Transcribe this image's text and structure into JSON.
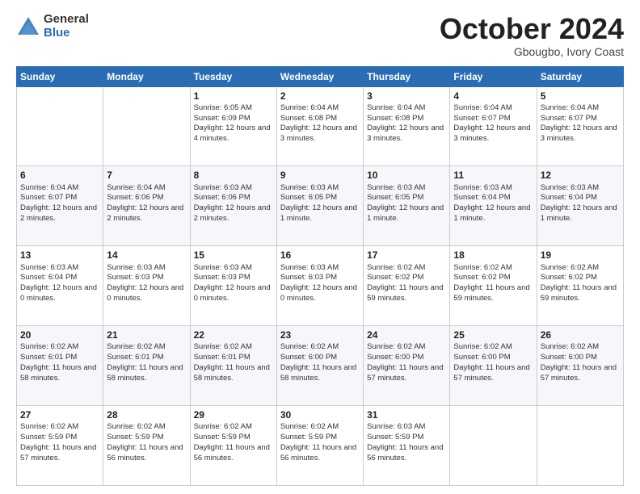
{
  "logo": {
    "general": "General",
    "blue": "Blue"
  },
  "header": {
    "month": "October 2024",
    "location": "Gbougbo, Ivory Coast"
  },
  "weekdays": [
    "Sunday",
    "Monday",
    "Tuesday",
    "Wednesday",
    "Thursday",
    "Friday",
    "Saturday"
  ],
  "weeks": [
    [
      {
        "day": "",
        "detail": ""
      },
      {
        "day": "",
        "detail": ""
      },
      {
        "day": "1",
        "detail": "Sunrise: 6:05 AM\nSunset: 6:09 PM\nDaylight: 12 hours\nand 4 minutes."
      },
      {
        "day": "2",
        "detail": "Sunrise: 6:04 AM\nSunset: 6:08 PM\nDaylight: 12 hours\nand 3 minutes."
      },
      {
        "day": "3",
        "detail": "Sunrise: 6:04 AM\nSunset: 6:08 PM\nDaylight: 12 hours\nand 3 minutes."
      },
      {
        "day": "4",
        "detail": "Sunrise: 6:04 AM\nSunset: 6:07 PM\nDaylight: 12 hours\nand 3 minutes."
      },
      {
        "day": "5",
        "detail": "Sunrise: 6:04 AM\nSunset: 6:07 PM\nDaylight: 12 hours\nand 3 minutes."
      }
    ],
    [
      {
        "day": "6",
        "detail": "Sunrise: 6:04 AM\nSunset: 6:07 PM\nDaylight: 12 hours\nand 2 minutes."
      },
      {
        "day": "7",
        "detail": "Sunrise: 6:04 AM\nSunset: 6:06 PM\nDaylight: 12 hours\nand 2 minutes."
      },
      {
        "day": "8",
        "detail": "Sunrise: 6:03 AM\nSunset: 6:06 PM\nDaylight: 12 hours\nand 2 minutes."
      },
      {
        "day": "9",
        "detail": "Sunrise: 6:03 AM\nSunset: 6:05 PM\nDaylight: 12 hours\nand 1 minute."
      },
      {
        "day": "10",
        "detail": "Sunrise: 6:03 AM\nSunset: 6:05 PM\nDaylight: 12 hours\nand 1 minute."
      },
      {
        "day": "11",
        "detail": "Sunrise: 6:03 AM\nSunset: 6:04 PM\nDaylight: 12 hours\nand 1 minute."
      },
      {
        "day": "12",
        "detail": "Sunrise: 6:03 AM\nSunset: 6:04 PM\nDaylight: 12 hours\nand 1 minute."
      }
    ],
    [
      {
        "day": "13",
        "detail": "Sunrise: 6:03 AM\nSunset: 6:04 PM\nDaylight: 12 hours\nand 0 minutes."
      },
      {
        "day": "14",
        "detail": "Sunrise: 6:03 AM\nSunset: 6:03 PM\nDaylight: 12 hours\nand 0 minutes."
      },
      {
        "day": "15",
        "detail": "Sunrise: 6:03 AM\nSunset: 6:03 PM\nDaylight: 12 hours\nand 0 minutes."
      },
      {
        "day": "16",
        "detail": "Sunrise: 6:03 AM\nSunset: 6:03 PM\nDaylight: 12 hours\nand 0 minutes."
      },
      {
        "day": "17",
        "detail": "Sunrise: 6:02 AM\nSunset: 6:02 PM\nDaylight: 11 hours\nand 59 minutes."
      },
      {
        "day": "18",
        "detail": "Sunrise: 6:02 AM\nSunset: 6:02 PM\nDaylight: 11 hours\nand 59 minutes."
      },
      {
        "day": "19",
        "detail": "Sunrise: 6:02 AM\nSunset: 6:02 PM\nDaylight: 11 hours\nand 59 minutes."
      }
    ],
    [
      {
        "day": "20",
        "detail": "Sunrise: 6:02 AM\nSunset: 6:01 PM\nDaylight: 11 hours\nand 58 minutes."
      },
      {
        "day": "21",
        "detail": "Sunrise: 6:02 AM\nSunset: 6:01 PM\nDaylight: 11 hours\nand 58 minutes."
      },
      {
        "day": "22",
        "detail": "Sunrise: 6:02 AM\nSunset: 6:01 PM\nDaylight: 11 hours\nand 58 minutes."
      },
      {
        "day": "23",
        "detail": "Sunrise: 6:02 AM\nSunset: 6:00 PM\nDaylight: 11 hours\nand 58 minutes."
      },
      {
        "day": "24",
        "detail": "Sunrise: 6:02 AM\nSunset: 6:00 PM\nDaylight: 11 hours\nand 57 minutes."
      },
      {
        "day": "25",
        "detail": "Sunrise: 6:02 AM\nSunset: 6:00 PM\nDaylight: 11 hours\nand 57 minutes."
      },
      {
        "day": "26",
        "detail": "Sunrise: 6:02 AM\nSunset: 6:00 PM\nDaylight: 11 hours\nand 57 minutes."
      }
    ],
    [
      {
        "day": "27",
        "detail": "Sunrise: 6:02 AM\nSunset: 5:59 PM\nDaylight: 11 hours\nand 57 minutes."
      },
      {
        "day": "28",
        "detail": "Sunrise: 6:02 AM\nSunset: 5:59 PM\nDaylight: 11 hours\nand 56 minutes."
      },
      {
        "day": "29",
        "detail": "Sunrise: 6:02 AM\nSunset: 5:59 PM\nDaylight: 11 hours\nand 56 minutes."
      },
      {
        "day": "30",
        "detail": "Sunrise: 6:02 AM\nSunset: 5:59 PM\nDaylight: 11 hours\nand 56 minutes."
      },
      {
        "day": "31",
        "detail": "Sunrise: 6:03 AM\nSunset: 5:59 PM\nDaylight: 11 hours\nand 56 minutes."
      },
      {
        "day": "",
        "detail": ""
      },
      {
        "day": "",
        "detail": ""
      }
    ]
  ]
}
